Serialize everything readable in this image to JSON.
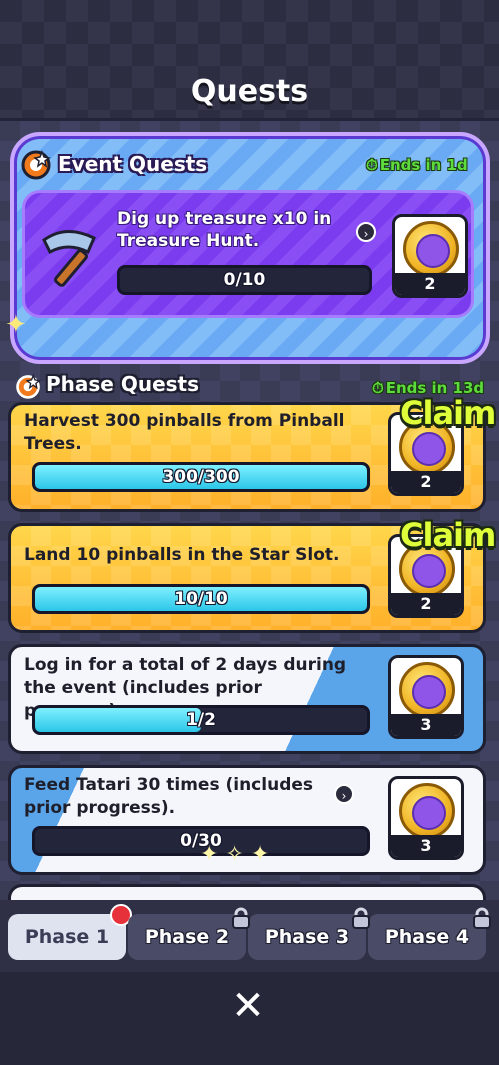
{
  "title": "Quests",
  "event": {
    "section_title": "Event Quests",
    "ends": "Ends in 1d",
    "quest": {
      "description": "Dig up treasure x10 in Treasure Hunt.",
      "progress_text": "0/10",
      "progress_fraction": 0.0,
      "reward_count": "2"
    }
  },
  "phase": {
    "section_title": "Phase Quests",
    "ends": "Ends in 13d",
    "claim_label": "Claim",
    "quests": [
      {
        "description": "Harvest 300 pinballs from Pinball Trees.",
        "progress_text": "300/300",
        "progress_fraction": 1.0,
        "reward_count": "2",
        "claimable": true
      },
      {
        "description": "Land 10 pinballs in the Star Slot.",
        "progress_text": "10/10",
        "progress_fraction": 1.0,
        "reward_count": "2",
        "claimable": true
      },
      {
        "description": "Log in for a total of 2 days during the event (includes prior progress).",
        "progress_text": "1/2",
        "progress_fraction": 0.5,
        "reward_count": "3",
        "claimable": false
      },
      {
        "description": "Feed Tatari 30 times (includes prior progress).",
        "progress_text": "0/30",
        "progress_fraction": 0.0,
        "reward_count": "3",
        "claimable": false
      }
    ]
  },
  "tabs": [
    {
      "label": "Phase 1",
      "active": true,
      "locked": false
    },
    {
      "label": "Phase 2",
      "active": false,
      "locked": true
    },
    {
      "label": "Phase 3",
      "active": false,
      "locked": true
    },
    {
      "label": "Phase 4",
      "active": false,
      "locked": true
    }
  ],
  "icons": {
    "close": "close-icon",
    "lock": "lock-icon",
    "clock": "stopwatch-icon",
    "hammer": "hammer-icon",
    "coin": "coin-icon",
    "chevron": "chevron-right-icon"
  },
  "colors": {
    "accent_green": "#5edb3d",
    "claim_yellow": "#dfff3a",
    "progress_cyan": "#2cc6e8",
    "event_purple": "#7b3cf0",
    "notify_red": "#e7313a"
  }
}
